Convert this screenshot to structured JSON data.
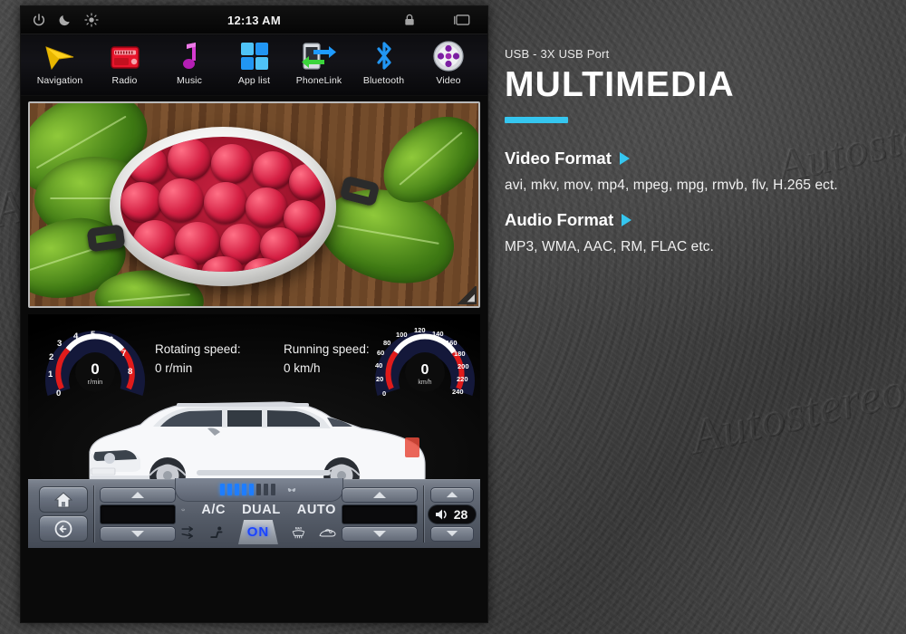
{
  "device": {
    "status_bar": {
      "time": "12:13 AM",
      "left_icons": [
        "power-icon",
        "night-mode-icon",
        "brightness-icon"
      ],
      "right_icons": [
        "lock-icon",
        "window-icon"
      ]
    },
    "app_bar": {
      "apps": [
        {
          "label": "Navigation",
          "icon": "navigation-arrow-icon"
        },
        {
          "label": "Radio",
          "icon": "radio-icon"
        },
        {
          "label": "Music",
          "icon": "music-note-icon"
        },
        {
          "label": "App list",
          "icon": "app-grid-icon"
        },
        {
          "label": "PhoneLink",
          "icon": "phonelink-icon"
        },
        {
          "label": "Bluetooth",
          "icon": "bluetooth-icon"
        },
        {
          "label": "Video",
          "icon": "video-reel-icon"
        }
      ]
    },
    "video_player": {
      "content_description": "raspberries-in-white-bowl",
      "resize_handle": "◢"
    },
    "dashboard": {
      "tachometer": {
        "value": "0",
        "unit": "r/min",
        "ticks": [
          "0",
          "1",
          "2",
          "3",
          "4",
          "5",
          "6",
          "7",
          "8"
        ]
      },
      "speedometer": {
        "value": "0",
        "unit": "km/h",
        "ticks": [
          "0",
          "20",
          "40",
          "60",
          "80",
          "100",
          "120",
          "140",
          "160",
          "180",
          "200",
          "220",
          "240"
        ]
      },
      "readouts": [
        {
          "label": "Rotating speed:",
          "value": "0 r/min"
        },
        {
          "label": "Running speed:",
          "value": "0 km/h"
        }
      ],
      "vehicle": "white-suv-toyota-land-cruiser-prado"
    },
    "climate_bar": {
      "home_button": "home-icon",
      "back_button": "back-arrow-icon",
      "left_temp": {
        "up": "▲",
        "down": "▼",
        "display": ""
      },
      "right_temp": {
        "up": "▲",
        "down": "▼",
        "display": ""
      },
      "labels": [
        "A/C",
        "DUAL",
        "AUTO"
      ],
      "on_button": "ON",
      "icons": [
        "front-defrost-icon",
        "airflow-icon",
        "seat-airflow-icon",
        "max-defrost-icon",
        "recirculation-icon"
      ],
      "fan_bars": [
        true,
        true,
        true,
        true,
        true,
        false,
        false,
        false
      ],
      "volume": {
        "icon": "speaker-icon",
        "value": "28"
      }
    }
  },
  "panel": {
    "kicker": "USB - 3X USB Port",
    "title": "MULTIMEDIA",
    "accent_color": "#35c6ef",
    "sections": [
      {
        "heading": "Video Format",
        "body": "avi, mkv, mov, mp4, mpeg, mpg, rmvb, flv, H.265 ect."
      },
      {
        "heading": "Audio Format",
        "body": "MP3, WMA, AAC, RM, FLAC etc."
      }
    ]
  },
  "watermark": {
    "text": "Autostereo"
  }
}
